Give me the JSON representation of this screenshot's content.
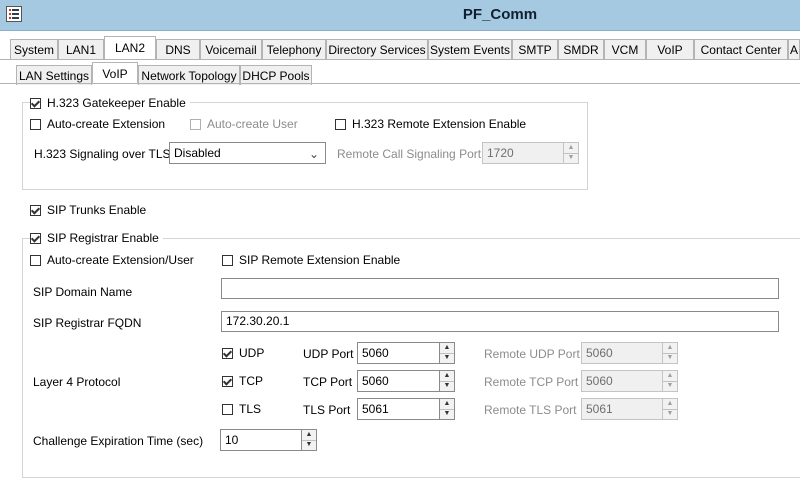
{
  "window": {
    "title": "PF_Comm",
    "icon": "list-icon"
  },
  "main_tabs": [
    {
      "label": "System"
    },
    {
      "label": "LAN1"
    },
    {
      "label": "LAN2",
      "active": true
    },
    {
      "label": "DNS"
    },
    {
      "label": "Voicemail"
    },
    {
      "label": "Telephony"
    },
    {
      "label": "Directory Services"
    },
    {
      "label": "System Events"
    },
    {
      "label": "SMTP"
    },
    {
      "label": "SMDR"
    },
    {
      "label": "VCM"
    },
    {
      "label": "VoIP"
    },
    {
      "label": "Contact Center"
    },
    {
      "label": "A"
    }
  ],
  "sub_tabs": [
    {
      "label": "LAN Settings"
    },
    {
      "label": "VoIP",
      "active": true
    },
    {
      "label": "Network Topology"
    },
    {
      "label": "DHCP Pools"
    }
  ],
  "h323": {
    "gatekeeper_enable": {
      "label": "H.323 Gatekeeper Enable",
      "checked": true
    },
    "auto_create_extension": {
      "label": "Auto-create Extension",
      "checked": false
    },
    "auto_create_user": {
      "label": "Auto-create User",
      "checked": false,
      "disabled": true
    },
    "remote_extension_enable": {
      "label": "H.323 Remote Extension Enable",
      "checked": false
    },
    "signaling_tls_label": "H.323 Signaling over TLS",
    "signaling_tls_value": "Disabled",
    "remote_call_signaling_port_label": "Remote Call Signaling Port",
    "remote_call_signaling_port_value": "1720"
  },
  "sip_trunks_enable": {
    "label": "SIP Trunks Enable",
    "checked": true
  },
  "sip_registrar": {
    "enable": {
      "label": "SIP Registrar Enable",
      "checked": true
    },
    "auto_create_extension_user": {
      "label": "Auto-create Extension/User",
      "checked": false
    },
    "remote_extension_enable": {
      "label": "SIP Remote Extension Enable",
      "checked": false
    },
    "domain_name_label": "SIP Domain Name",
    "domain_name_value": "",
    "fqdn_label": "SIP Registrar FQDN",
    "fqdn_value": "172.30.20.1",
    "layer4_label": "Layer 4 Protocol",
    "protocols": [
      {
        "name": "UDP",
        "checked": true,
        "port_label": "UDP Port",
        "port": "5060",
        "remote_label": "Remote UDP Port",
        "remote_port": "5060"
      },
      {
        "name": "TCP",
        "checked": true,
        "port_label": "TCP Port",
        "port": "5060",
        "remote_label": "Remote TCP Port",
        "remote_port": "5060"
      },
      {
        "name": "TLS",
        "checked": false,
        "port_label": "TLS Port",
        "port": "5061",
        "remote_label": "Remote TLS Port",
        "remote_port": "5061"
      }
    ],
    "challenge_label": "Challenge Expiration Time (sec)",
    "challenge_value": "10"
  }
}
